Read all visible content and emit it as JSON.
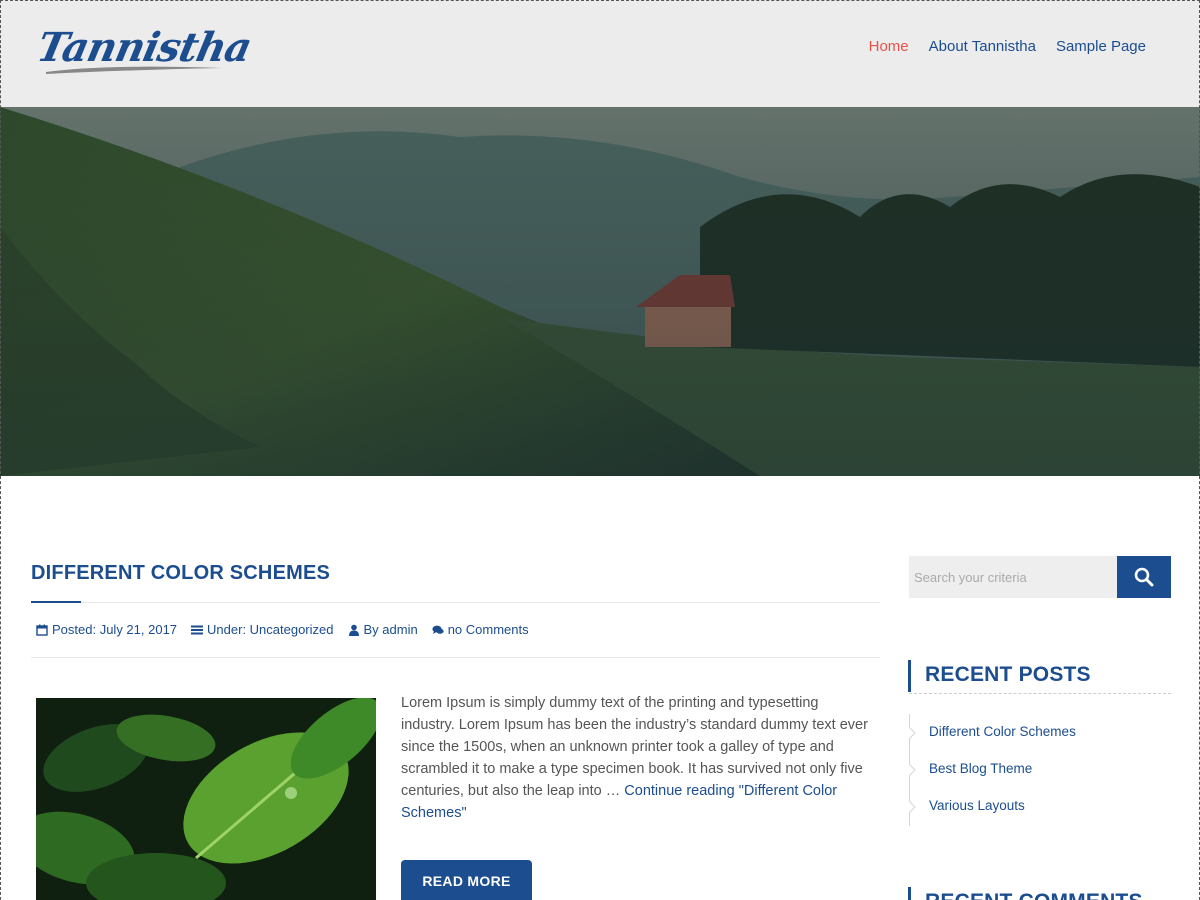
{
  "site": {
    "logo_text": "Tannistha"
  },
  "nav": {
    "items": [
      {
        "label": "Home",
        "active": true
      },
      {
        "label": "About Tannistha",
        "active": false
      },
      {
        "label": "Sample Page",
        "active": false
      }
    ]
  },
  "post": {
    "title": "DIFFERENT COLOR SCHEMES",
    "meta": {
      "posted": "Posted: July 21, 2017",
      "under": "Under: Uncategorized",
      "by": "By admin",
      "comments": "no Comments"
    },
    "excerpt": "Lorem Ipsum is simply dummy text of the printing and typesetting industry. Lorem Ipsum has been the industry’s standard dummy text ever since the 1500s, when an unknown printer took a galley of type and scrambled it to make a type specimen book. It has survived not only five centuries, but also the leap into …",
    "continue_link": "Continue reading \"Different Color Schemes\"",
    "read_more_label": "READ MORE"
  },
  "sidebar": {
    "search": {
      "placeholder": "Search your criteria"
    },
    "recent_posts": {
      "title": "RECENT POSTS",
      "items": [
        "Different Color Schemes",
        "Best Blog Theme",
        "Various Layouts"
      ]
    },
    "recent_comments": {
      "title": "RECENT COMMENTS"
    }
  },
  "colors": {
    "primary": "#1b4d8f",
    "active_nav": "#e5534b",
    "header_bg": "#ececec"
  },
  "icons": [
    "calendar-icon",
    "list-icon",
    "user-icon",
    "comments-icon",
    "search-icon",
    "chevron-right-icon"
  ]
}
